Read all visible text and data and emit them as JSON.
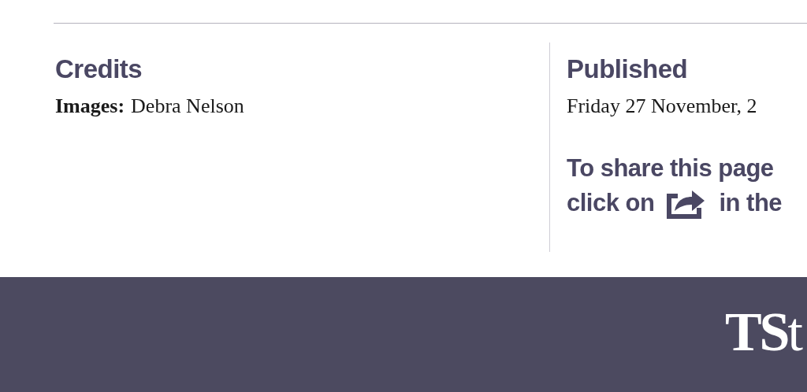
{
  "credits": {
    "heading": "Credits",
    "label": "Images:",
    "value": "Debra Nelson"
  },
  "published": {
    "heading": "Published",
    "date": "Friday 27 November, 2",
    "share_before": "To share this page",
    "share_click": "click on",
    "share_after": "in the"
  },
  "footer": {
    "logo": "**TS**t"
  }
}
